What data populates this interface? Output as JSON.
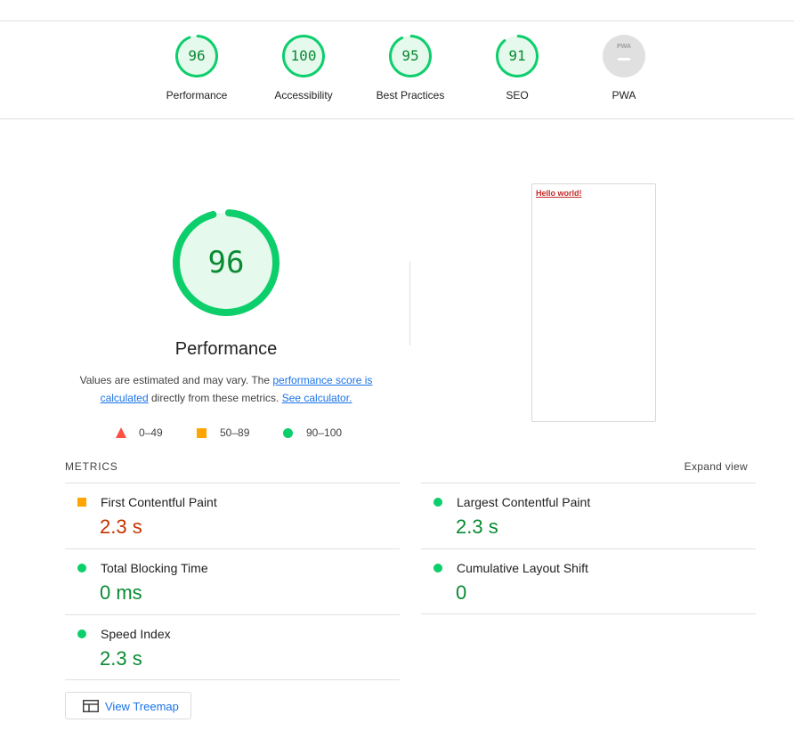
{
  "categories": [
    {
      "label": "Performance",
      "score": "96",
      "value": 96
    },
    {
      "label": "Accessibility",
      "score": "100",
      "value": 100
    },
    {
      "label": "Best Practices",
      "score": "95",
      "value": 95
    },
    {
      "label": "SEO",
      "score": "91",
      "value": 91
    },
    {
      "label": "PWA",
      "badge_text": "PWA"
    }
  ],
  "performance": {
    "score": "96",
    "value": 96,
    "title": "Performance",
    "desc_prefix": "Values are estimated and may vary. The ",
    "desc_link1": "performance score is calculated",
    "desc_middle": " directly from these metrics. ",
    "desc_link2": "See calculator."
  },
  "legend": {
    "fail": "0–49",
    "average": "50–89",
    "pass": "90–100"
  },
  "screenshot": {
    "text": "Hello world!"
  },
  "metrics": {
    "heading": "METRICS",
    "expand_label": "Expand view",
    "left": [
      {
        "name": "First Contentful Paint",
        "value": "2.3 s",
        "status": "average"
      },
      {
        "name": "Total Blocking Time",
        "value": "0 ms",
        "status": "pass"
      },
      {
        "name": "Speed Index",
        "value": "2.3 s",
        "status": "pass"
      }
    ],
    "right": [
      {
        "name": "Largest Contentful Paint",
        "value": "2.3 s",
        "status": "pass"
      },
      {
        "name": "Cumulative Layout Shift",
        "value": "0",
        "status": "pass"
      }
    ]
  },
  "treemap": {
    "label": "View Treemap"
  },
  "colors": {
    "pass": "#0cce6b",
    "pass_text": "#0a8a33",
    "average": "#ffa400",
    "fail": "#ff4e42",
    "link": "#1a73e8"
  }
}
